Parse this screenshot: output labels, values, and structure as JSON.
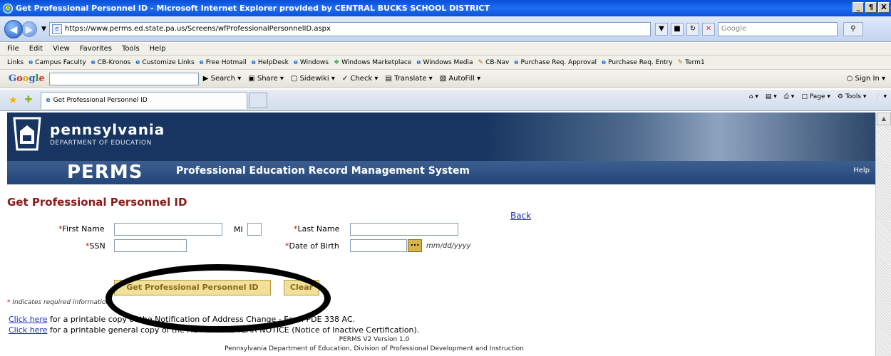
{
  "window": {
    "title": "Get Professional Personnel ID - Microsoft Internet Explorer provided by CENTRAL BUCKS SCHOOL DISTRICT",
    "controls": [
      "_",
      "¶",
      "X"
    ]
  },
  "address_bar": {
    "url": "https://www.perms.ed.state.pa.us/Screens/wfProfessionalPersonnelID.aspx",
    "search_placeholder": "Google"
  },
  "menu": [
    "File",
    "Edit",
    "View",
    "Favorites",
    "Tools",
    "Help"
  ],
  "links_bar": {
    "label": "Links",
    "items": [
      "Campus Faculty",
      "CB-Kronos",
      "Customize Links",
      "Free Hotmail",
      "HelpDesk",
      "Windows",
      "Windows Marketplace",
      "Windows Media",
      "CB-Nav",
      "Purchase Req. Approval",
      "Purchase Req. Entry",
      "Term1"
    ]
  },
  "google_toolbar": {
    "logo": "Google",
    "items": [
      "Search",
      "Share",
      "Sidewiki",
      "Check",
      "Translate",
      "AutoFill"
    ],
    "signin": "Sign In"
  },
  "tab": {
    "title": "Get Professional Personnel ID"
  },
  "command_bar": [
    "Page",
    "Tools"
  ],
  "banner": {
    "state": "pennsylvania",
    "department": "DEPARTMENT OF EDUCATION",
    "app_short": "PERMS",
    "app_full": "Professional Education Record Management System",
    "help": "Help"
  },
  "page": {
    "title": "Get Professional Personnel ID",
    "back_link": "Back"
  },
  "form": {
    "first_name_label": "First Name",
    "mi_label": "MI",
    "last_name_label": "Last Name",
    "ssn_label": "SSN",
    "dob_label": "Date of Birth",
    "dob_hint": "mm/dd/yyyy",
    "date_button": "...",
    "required_mark": "*",
    "submit_button": "Get Professional Personnel ID",
    "clear_button": "Clear",
    "required_note_star": "*",
    "required_note": "Indicates required information"
  },
  "links": [
    {
      "link": "Click here",
      "text": "for a printable copy of the Notification of Address Change - Form PDE 338 AC."
    },
    {
      "link": "Click here",
      "text": "for a printable general copy of the ACT 48 FIVE-YEAR NOTICE (Notice of Inactive Certification)."
    }
  ],
  "footer": {
    "version": "PERMS V2 Version 1.0",
    "org": "Pennsylvania Department of Education, Division of Professional Development and Instruction"
  }
}
